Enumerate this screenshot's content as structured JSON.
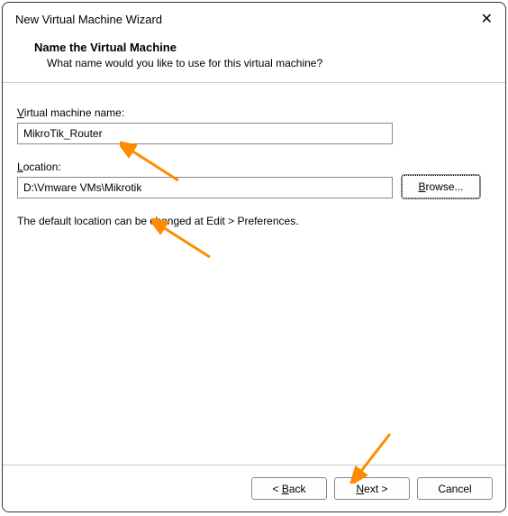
{
  "window": {
    "title": "New Virtual Machine Wizard"
  },
  "header": {
    "heading": "Name the Virtual Machine",
    "subtext": "What name would you like to use for this virtual machine?"
  },
  "fields": {
    "name_label_prefix": "V",
    "name_label_rest": "irtual machine name:",
    "name_value": "MikroTik_Router",
    "location_label_prefix": "L",
    "location_label_rest": "ocation:",
    "location_value": "D:\\Vmware VMs\\Mikrotik",
    "browse_prefix": "B",
    "browse_rest": "rowse..."
  },
  "hint": "The default location can be changed at Edit > Preferences.",
  "buttons": {
    "back_prefix": "< ",
    "back_ul": "B",
    "back_rest": "ack",
    "next_ul": "N",
    "next_rest": "ext >",
    "cancel": "Cancel"
  }
}
